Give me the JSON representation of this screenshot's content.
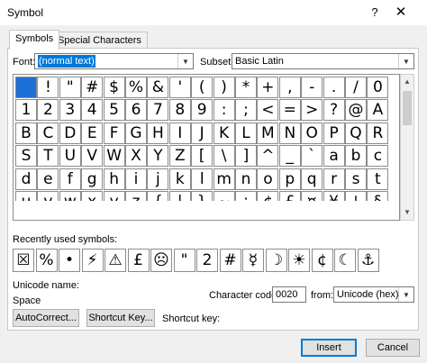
{
  "window": {
    "title": "Symbol",
    "help": "?",
    "close": "✕"
  },
  "tabs": [
    {
      "label": "Symbols",
      "active": true
    },
    {
      "label": "Special Characters",
      "active": false
    }
  ],
  "font": {
    "label": "Font:",
    "value": "(normal text)"
  },
  "subset": {
    "label": "Subset:",
    "value": "Basic Latin"
  },
  "symbol_grid": {
    "rows": [
      [
        " ",
        "!",
        "\"",
        "#",
        "$",
        "%",
        "&",
        "'",
        "(",
        ")",
        "*",
        "+",
        ",",
        "-",
        ".",
        "/",
        "0"
      ],
      [
        "1",
        "2",
        "3",
        "4",
        "5",
        "6",
        "7",
        "8",
        "9",
        ":",
        ";",
        "<",
        "=",
        ">",
        "?",
        "@",
        "A"
      ],
      [
        "B",
        "C",
        "D",
        "E",
        "F",
        "G",
        "H",
        "I",
        "J",
        "K",
        "L",
        "M",
        "N",
        "O",
        "P",
        "Q",
        "R"
      ],
      [
        "S",
        "T",
        "U",
        "V",
        "W",
        "X",
        "Y",
        "Z",
        "[",
        "\\",
        "]",
        "^",
        "_",
        "`",
        "a",
        "b",
        "c"
      ],
      [
        "d",
        "e",
        "f",
        "g",
        "h",
        "i",
        "j",
        "k",
        "l",
        "m",
        "n",
        "o",
        "p",
        "q",
        "r",
        "s",
        "t"
      ],
      [
        "u",
        "v",
        "w",
        "x",
        "y",
        "z",
        "{",
        "|",
        "}",
        "~",
        "¡",
        "¢",
        "£",
        "¤",
        "¥",
        "¦",
        "§"
      ]
    ],
    "selected_index": 0
  },
  "recent": {
    "label": "Recently used symbols:",
    "symbols": [
      "☒",
      "%",
      "•",
      "⚡",
      "⚠",
      "£",
      "☹",
      "\"",
      "2",
      "#",
      "☿",
      "☽",
      "☀",
      "¢",
      "☾",
      "⚓"
    ]
  },
  "unicode_name": {
    "label": "Unicode name:",
    "value": "Space"
  },
  "char_code": {
    "label": "Character code:",
    "value": "0020"
  },
  "from": {
    "label": "from:",
    "value": "Unicode (hex)"
  },
  "buttons": {
    "autocorrect": "AutoCorrect...",
    "shortcut_key": "Shortcut Key...",
    "insert": "Insert",
    "cancel": "Cancel"
  },
  "shortcut_label": "Shortcut key:",
  "colors": {
    "selection": "#1e6fd8",
    "accent": "#0078d7"
  }
}
